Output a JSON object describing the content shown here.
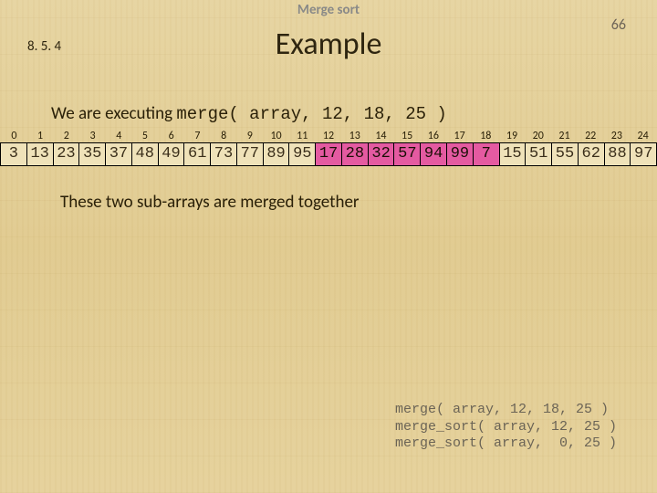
{
  "header": {
    "topic": "Merge sort",
    "slide_number": "66",
    "section_number": "8. 5. 4",
    "title": "Example"
  },
  "body": {
    "line1_prefix": "We are executing ",
    "line1_code": "merge( array, 12, 18, 25 )",
    "line2": "These two sub-arrays are merged together"
  },
  "array": {
    "indices": [
      "0",
      "1",
      "2",
      "3",
      "4",
      "5",
      "6",
      "7",
      "8",
      "9",
      "10",
      "11",
      "12",
      "13",
      "14",
      "15",
      "16",
      "17",
      "18",
      "19",
      "20",
      "21",
      "22",
      "23",
      "24"
    ],
    "values": [
      "3",
      "13",
      "23",
      "35",
      "37",
      "48",
      "49",
      "61",
      "73",
      "77",
      "89",
      "95",
      "17",
      "28",
      "32",
      "57",
      "94",
      "99",
      "7",
      "15",
      "51",
      "55",
      "62",
      "88",
      "97"
    ],
    "highlight_start": 12,
    "highlight_end": 18
  },
  "callstack": [
    "merge( array, 12, 18, 25 )",
    "merge_sort( array, 12, 25 )",
    "merge_sort( array,  0, 25 )"
  ]
}
